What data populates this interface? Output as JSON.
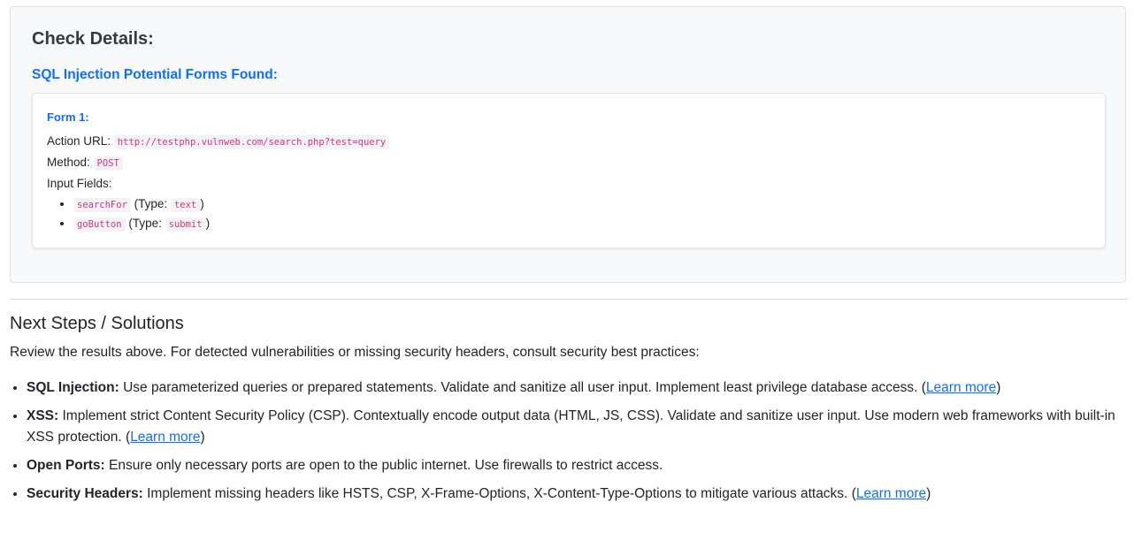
{
  "details": {
    "title": "Check Details:",
    "sqli_heading": "SQL Injection Potential Forms Found:",
    "form": {
      "title": "Form 1:",
      "action_label": "Action URL:",
      "action_url": "http://testphp.vulnweb.com/search.php?test=query",
      "method_label": "Method:",
      "method": "POST",
      "inputs_label": "Input Fields:",
      "type_prefix": "(Type:",
      "type_suffix": ")",
      "fields": [
        {
          "name": "searchFor",
          "type": "text"
        },
        {
          "name": "goButton",
          "type": "submit"
        }
      ]
    }
  },
  "next_steps": {
    "title": "Next Steps / Solutions",
    "intro": "Review the results above. For detected vulnerabilities or missing security headers, consult security best practices:",
    "link_open": "(",
    "link_close": ")",
    "items": [
      {
        "term": "SQL Injection:",
        "text": "Use parameterized queries or prepared statements. Validate and sanitize all user input. Implement least privilege database access.",
        "link": "Learn more"
      },
      {
        "term": "XSS:",
        "text": "Implement strict Content Security Policy (CSP). Contextually encode output data (HTML, JS, CSS). Validate and sanitize user input. Use modern web frameworks with built-in XSS protection.",
        "link": "Learn more"
      },
      {
        "term": "Open Ports:",
        "text": "Ensure only necessary ports are open to the public internet. Use firewalls to restrict access.",
        "link": ""
      },
      {
        "term": "Security Headers:",
        "text": "Implement missing headers like HSTS, CSP, X-Frame-Options, X-Content-Type-Options to mitigate various attacks.",
        "link": "Learn more"
      }
    ]
  },
  "colors": {
    "accent": "#0d6efd",
    "code_text": "#d63384",
    "panel_bg": "#f8f9fa"
  }
}
